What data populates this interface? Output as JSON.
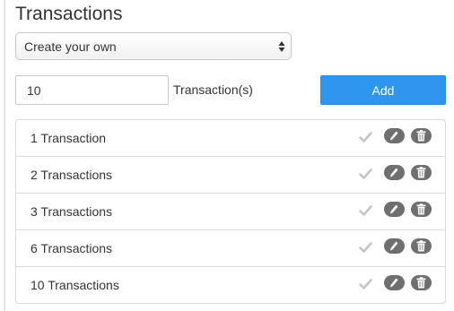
{
  "heading": "Transactions",
  "preset_select": {
    "value": "Create your own"
  },
  "quantity": {
    "value": "10",
    "unit": "Transaction(s)"
  },
  "add_button": "Add",
  "transactions": [
    {
      "label": "1 Transaction"
    },
    {
      "label": "2 Transactions"
    },
    {
      "label": "3 Transactions"
    },
    {
      "label": "6 Transactions"
    },
    {
      "label": "10 Transactions"
    }
  ],
  "icons": {
    "check": "check-icon",
    "edit": "pencil-icon",
    "delete": "trash-icon",
    "select": "up-down-arrows-icon"
  },
  "colors": {
    "accent": "#2f96ef",
    "icon_button": "#6f6f6f",
    "check": "#c4c4c4",
    "border": "#dcdcdc"
  }
}
